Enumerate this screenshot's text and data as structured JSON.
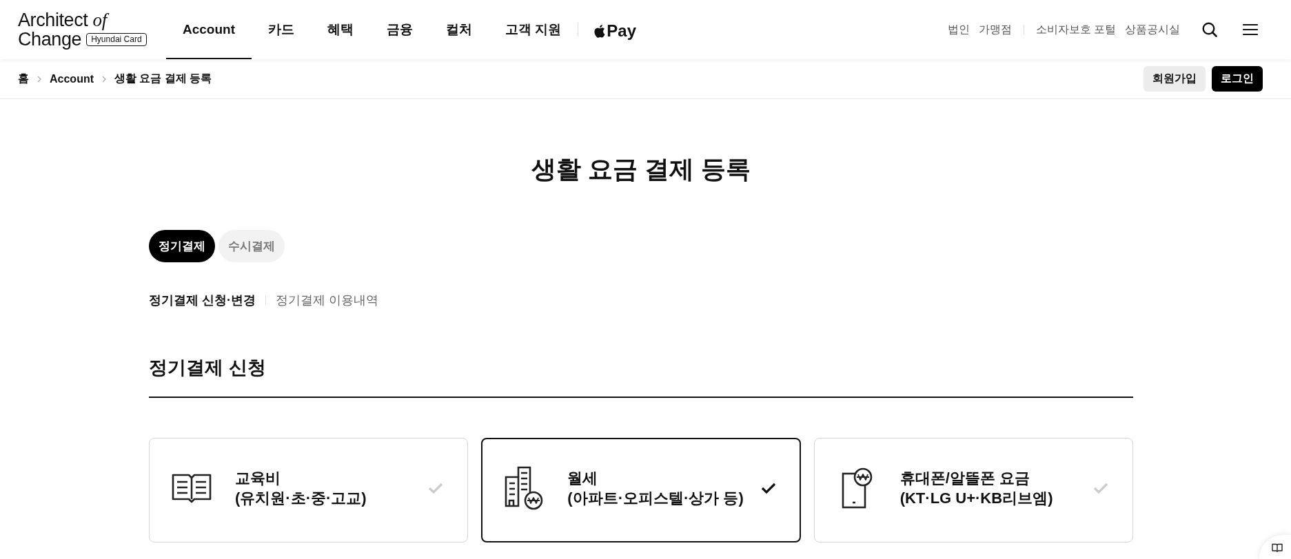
{
  "header": {
    "logo": {
      "line_1": "Architect *of*",
      "line_2": "Change",
      "badge": "Hyundai Card"
    },
    "nav": [
      {
        "label": "Account",
        "selected": true
      },
      {
        "label": "카드",
        "selected": false
      },
      {
        "label": "혜택",
        "selected": false
      },
      {
        "label": "금융",
        "selected": false
      },
      {
        "label": "컬처",
        "selected": false
      },
      {
        "label": "고객 지원",
        "selected": false
      }
    ],
    "apple_pay": {
      "label": "Pay"
    },
    "utility_groups": [
      {
        "links": [
          "법인",
          "가맹점"
        ]
      },
      {
        "links": [
          "소비자보호 포털",
          "상품공시실"
        ]
      }
    ]
  },
  "breadcrumb": [
    "홈",
    "Account",
    "생활 요금 결제 등록"
  ],
  "auth_buttons": [
    {
      "label": "회원가입",
      "kind": "secondary"
    },
    {
      "label": "로그인",
      "kind": "primary"
    }
  ],
  "page_title": "생활 요금 결제 등록",
  "payment_tabs": [
    {
      "label": "정기결제",
      "selected": true
    },
    {
      "label": "수시결제",
      "selected": false
    }
  ],
  "sub_tabs": [
    {
      "label": "정기결제 신청·변경",
      "selected": true
    },
    {
      "label": "정기결제 이용내역",
      "selected": false
    }
  ],
  "section_heading": "정기결제 신청",
  "cards": [
    {
      "kind": "education",
      "title": "교육비",
      "subtitle": "(유치원·초·중·고교)",
      "selected": false
    },
    {
      "kind": "rent",
      "title": "월세",
      "subtitle": "(아파트·오피스텔·상가 등)",
      "selected": true
    },
    {
      "kind": "phone",
      "title": "휴대폰/알뜰폰 요금",
      "subtitle": "(KT·LG U+·KB리브엠)",
      "selected": false
    }
  ]
}
